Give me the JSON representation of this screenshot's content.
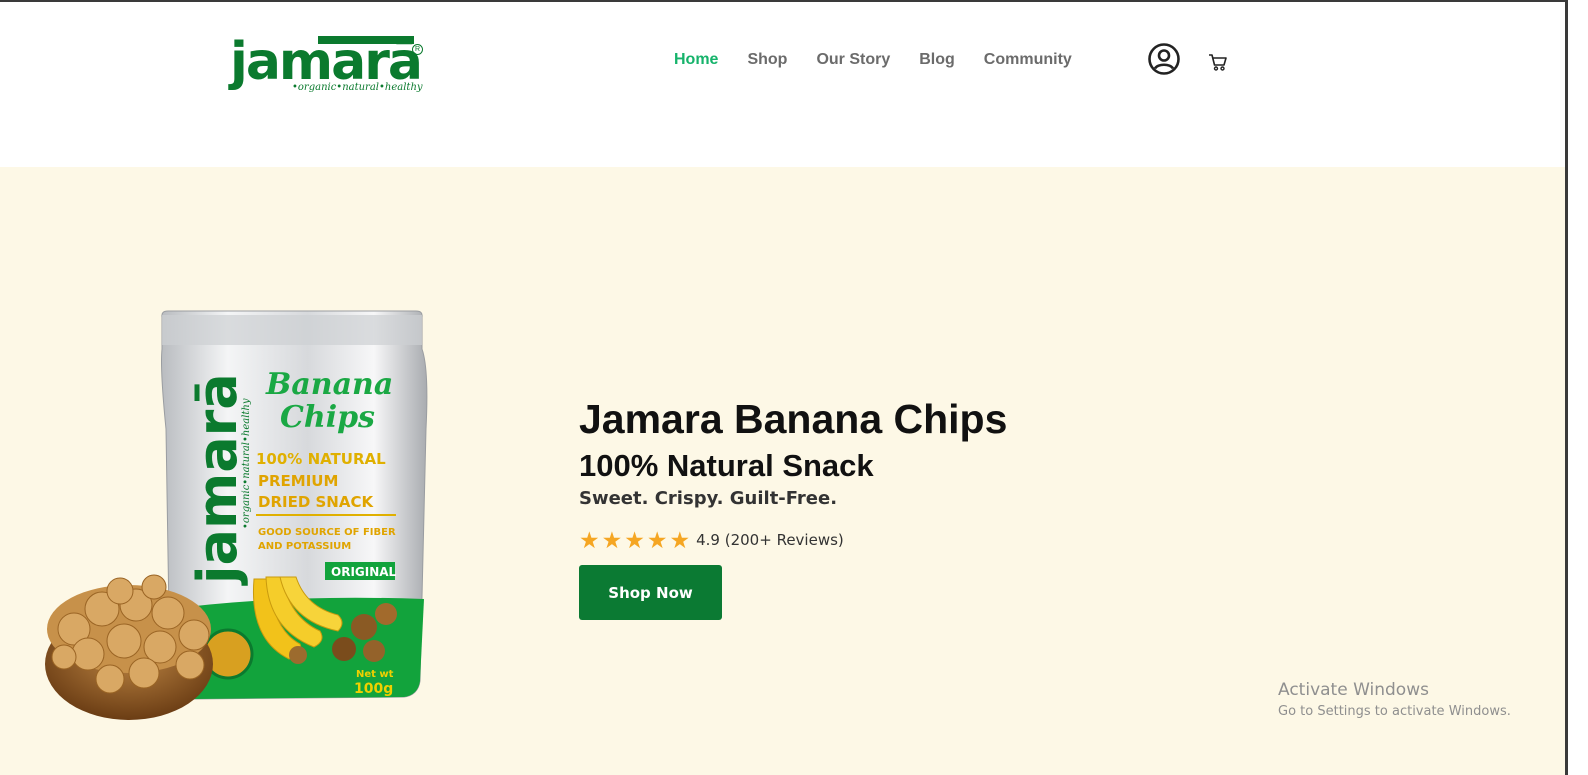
{
  "logo": {
    "word": "jamarā",
    "tagline": "•organic•natural•healthy",
    "reg": "R"
  },
  "nav": {
    "items": [
      {
        "label": "Home",
        "active": true
      },
      {
        "label": "Shop",
        "active": false
      },
      {
        "label": "Our Story",
        "active": false
      },
      {
        "label": "Blog",
        "active": false
      },
      {
        "label": "Community",
        "active": false
      }
    ]
  },
  "icons": {
    "account": "user-circle-icon",
    "cart": "cart-icon"
  },
  "hero": {
    "title": "Jamara Banana Chips",
    "subtitle": "100% Natural Snack",
    "tagline": "Sweet. Crispy. Guilt-Free.",
    "rating_text": "4.9 (200+ Reviews)",
    "rating_stars": 5,
    "cta_label": "Shop Now",
    "background_color": "#fdf8e6",
    "cta_color": "#0b7a33",
    "star_color": "#f5a623"
  },
  "package": {
    "brand": "jamarā",
    "brand_tagline": "•organic•natural•healthy",
    "product_line1": "Banana",
    "product_line2": "Chips",
    "claim1": "100% NATURAL",
    "claim2": "PREMIUM",
    "claim3": "DRIED SNACK",
    "benefit1": "GOOD SOURCE OF FIBER",
    "benefit2": "AND POTASSIUM",
    "variant": "ORIGINAL",
    "net_weight_label": "Net wt",
    "net_weight": "100g"
  },
  "watermark": {
    "heading": "Activate Windows",
    "sub": "Go to Settings to activate Windows."
  },
  "colors": {
    "brand_green": "#0b7a2e",
    "nav_active": "#16b36b",
    "nav_text": "#6b6b6b"
  }
}
